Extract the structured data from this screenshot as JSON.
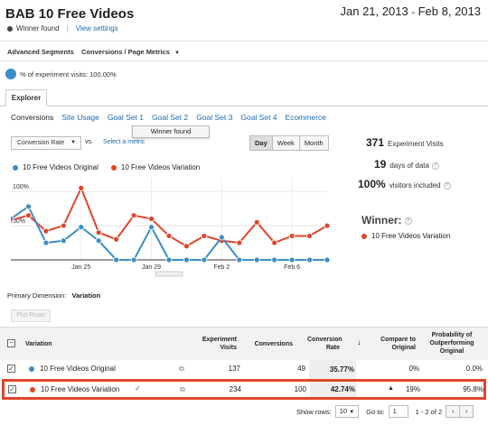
{
  "header": {
    "title": "BAB 10 Free Videos",
    "date_start": "Jan 21, 2013",
    "date_sep": "-",
    "date_end": "Feb 8, 2013",
    "status": "Winner found",
    "view_settings": "View settings"
  },
  "toolbar": {
    "advanced_segments": "Advanced Segments",
    "metrics_menu": "Conversions / Page Metrics"
  },
  "visits_pct": "% of experiment visits: 100.00%",
  "tabs": {
    "explorer": "Explorer"
  },
  "subtabs": [
    "Conversions",
    "Site Usage",
    "Goal Set 1",
    "Goal Set 2",
    "Goal Set 3",
    "Goal Set 4",
    "Ecommerce"
  ],
  "tooltip": "Winner found",
  "metric_select": {
    "value": "Conversion Rate",
    "vs": "vs.",
    "select_metric": "Select a metric"
  },
  "periods": [
    "Day",
    "Week",
    "Month"
  ],
  "legend": {
    "original": "10 Free Videos Original",
    "variation": "10 Free Videos Variation"
  },
  "colors": {
    "original": "#3b8ec7",
    "variation": "#e0452a",
    "accent": "#1a6bb0",
    "highlight": "#e0452a"
  },
  "chart_data": {
    "type": "line",
    "x": [
      "Jan 21",
      "Jan 22",
      "Jan 23",
      "Jan 24",
      "Jan 25",
      "Jan 26",
      "Jan 27",
      "Jan 28",
      "Jan 29",
      "Jan 30",
      "Jan 31",
      "Feb 1",
      "Feb 2",
      "Feb 3",
      "Feb 4",
      "Feb 5",
      "Feb 6",
      "Feb 7",
      "Feb 8"
    ],
    "x_tick_labels": [
      "Jan 25",
      "Jan 29",
      "Feb 2",
      "Feb 6"
    ],
    "x_tick_index": [
      4,
      8,
      12,
      16
    ],
    "y_tick_labels": [
      "100%",
      "50%"
    ],
    "y_ticks": [
      100,
      50
    ],
    "ylim": [
      0,
      120
    ],
    "series": [
      {
        "name": "10 Free Videos Original",
        "values": [
          60,
          78,
          25,
          28,
          48,
          28,
          0,
          0,
          48,
          0,
          0,
          0,
          33,
          0,
          0,
          0,
          0,
          0,
          0
        ]
      },
      {
        "name": "10 Free Videos Variation",
        "values": [
          58,
          65,
          42,
          50,
          105,
          40,
          30,
          65,
          60,
          35,
          20,
          35,
          28,
          25,
          55,
          25,
          35,
          35,
          50
        ]
      }
    ]
  },
  "stats": {
    "visits_value": "371",
    "visits_label": "Experiment Visits",
    "days_value": "19",
    "days_label": "days of data",
    "included_value": "100%",
    "included_label": "visitors included",
    "winner_label": "Winner:",
    "winner_name": "10 Free Videos Variation"
  },
  "primary_dimension": {
    "label": "Primary Dimension:",
    "value": "Variation"
  },
  "plot_rows": "Plot Rows",
  "table": {
    "headers": {
      "variation": "Variation",
      "visits": "Experiment Visits",
      "conversions": "Conversions",
      "rate": "Conversion Rate",
      "compare": "Compare to Original",
      "probability": "Probability of Outperforming Original"
    },
    "rows": [
      {
        "name": "10 Free Videos Original",
        "visits": "137",
        "conversions": "49",
        "rate": "35.77%",
        "compare": "0%",
        "probability": "0.0%"
      },
      {
        "name": "10 Free Videos Variation",
        "visits": "234",
        "conversions": "100",
        "rate": "42.74%",
        "compare": "19%",
        "probability": "95.8%"
      }
    ]
  },
  "footer": {
    "show_rows": "Show rows:",
    "rows_value": "10",
    "goto": "Go to:",
    "goto_value": "1",
    "range": "1 - 2 of 2"
  }
}
